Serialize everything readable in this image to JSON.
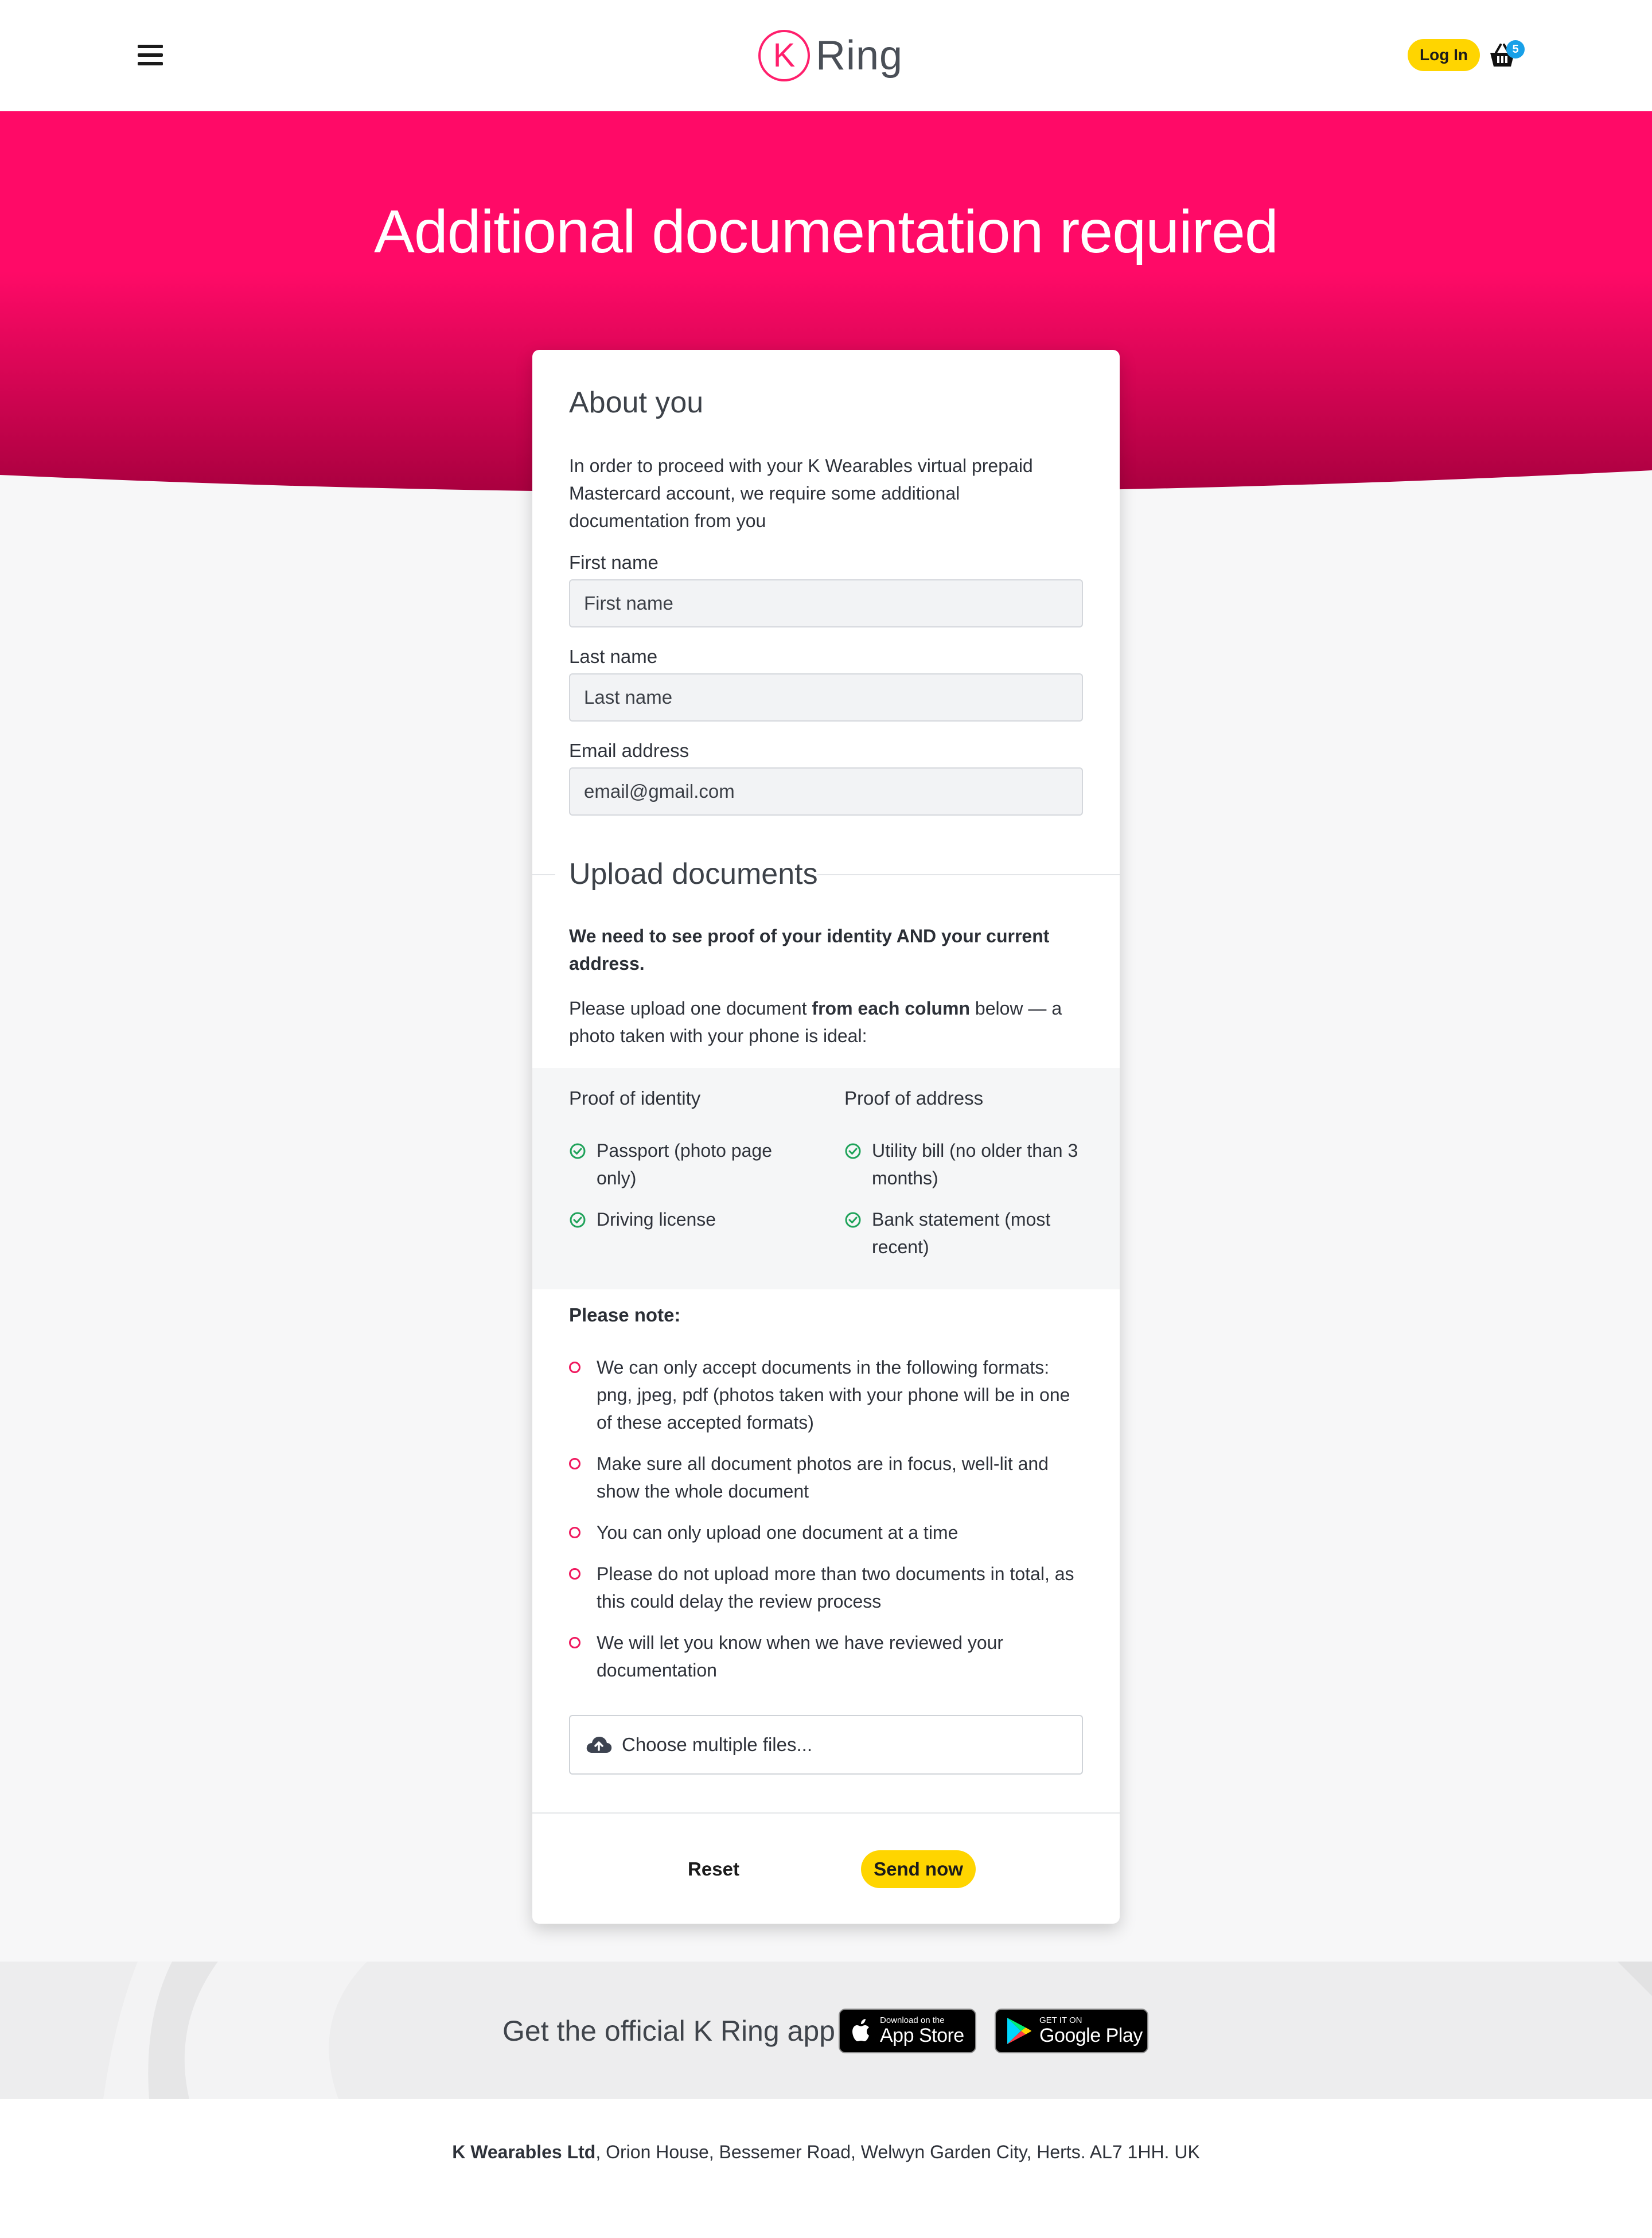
{
  "header": {
    "logo_letter": "K",
    "logo_word": "Ring",
    "login_label": "Log In",
    "basket_count": "5"
  },
  "hero": {
    "title": "Additional documentation required"
  },
  "about": {
    "title": "About you",
    "intro": "In order to proceed with your K Wearables virtual prepaid Mastercard account, we require some additional documentation from you",
    "fields": [
      {
        "label": "First name",
        "placeholder": "First name",
        "value": ""
      },
      {
        "label": "Last name",
        "placeholder": "Last name",
        "value": ""
      },
      {
        "label": "Email address",
        "placeholder": "email@gmail.com",
        "value": ""
      }
    ]
  },
  "upload": {
    "title": "Upload documents",
    "statement": "We need to see proof of your identity AND your current address.",
    "instruction_pre": "Please upload one document ",
    "instruction_bold": "from each column",
    "instruction_post": " below — a photo taken with your phone is ideal:",
    "identity": {
      "heading": "Proof of identity",
      "items": [
        "Passport (photo page only)",
        "Driving license"
      ]
    },
    "address": {
      "heading": "Proof of address",
      "items": [
        "Utility bill (no older than 3 months)",
        "Bank statement (most recent)"
      ]
    },
    "note_title": "Please note:",
    "notes": [
      "We can only accept documents in the following formats: png, jpeg, pdf (photos taken with your phone will be in one of these accepted formats)",
      "Make sure all document photos are in focus, well-lit and show the whole document",
      "You can only upload one document at a time",
      "Please do not upload more than two documents in total, as this could delay the review process",
      "We will let you know when we have reviewed your documentation"
    ],
    "file_picker_label": "Choose multiple files..."
  },
  "actions": {
    "reset_label": "Reset",
    "send_label": "Send now"
  },
  "app_banner": {
    "text": "Get the official K Ring app",
    "appstore_small": "Download on the",
    "appstore_big": "App Store",
    "googleplay_small": "GET IT ON",
    "googleplay_big": "Google Play"
  },
  "footer": {
    "company": "K Wearables Ltd",
    "address": ", Orion House, Bessemer Road, Welwyn Garden City, Herts. AL7 1HH. UK"
  },
  "colors": {
    "brand_pink": "#ff0a67",
    "accent_yellow": "#ffd500",
    "check_green": "#1fa35a",
    "badge_blue": "#18a0e8"
  }
}
